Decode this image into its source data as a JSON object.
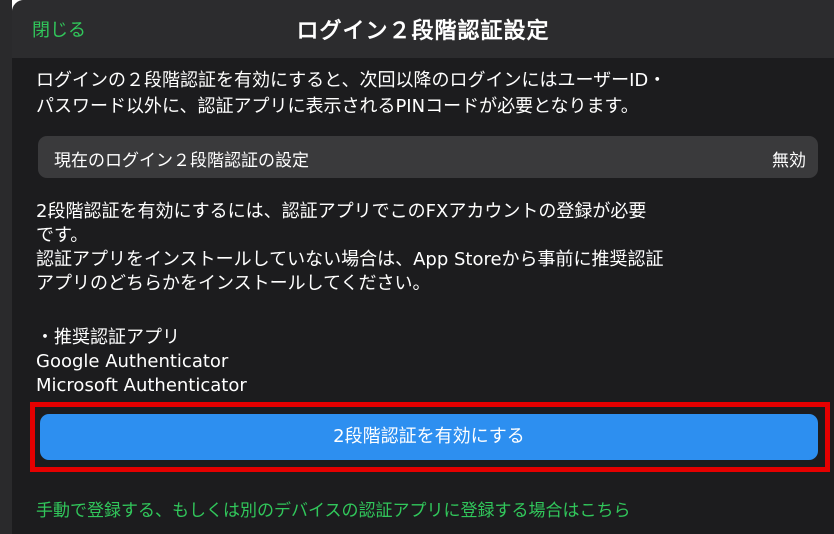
{
  "navbar": {
    "close_label": "閉じる",
    "title": "ログイン２段階認証設定"
  },
  "intro": {
    "line1": "ログインの２段階認証を有効にすると、次回以降のログインにはユーザーID・",
    "line2": "パスワード以外に、認証アプリに表示されるPINコードが必要となります。"
  },
  "setting": {
    "label": "現在のログイン２段階認証の設定",
    "value": "無効"
  },
  "body": {
    "para1_line1": "2段階認証を有効にするには、認証アプリでこのFXアカウントの登録が必要",
    "para1_line2": "です。",
    "para2_line1": "認証アプリをインストールしていない場合は、App Storeから事前に推奨認証",
    "para2_line2": "アプリのどちらかをインストールしてください。"
  },
  "recommended": {
    "heading": "・推奨認証アプリ",
    "apps": [
      "Google Authenticator",
      "Microsoft Authenticator"
    ]
  },
  "enable_button_label": "2段階認証を有効にする",
  "manual_link": "手動で登録する、もしくは別のデバイスの認証アプリに登録する場合はこちら",
  "colors": {
    "accent_green": "#31c75b",
    "button_blue": "#2d8ff0",
    "highlight_red": "#e50000",
    "background": "#1c1c1e"
  }
}
